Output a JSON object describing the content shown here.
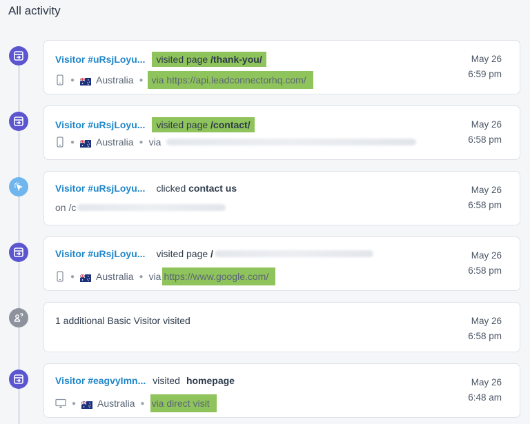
{
  "page": {
    "title": "All activity"
  },
  "colors": {
    "visit_icon": "#5b55cf",
    "click_icon": "#6fb6ef",
    "basic_icon": "#8d929c",
    "highlight": "#8fc35b",
    "link": "#1f86c9"
  },
  "activities": [
    {
      "type": "visit",
      "icon": "enter-page-icon",
      "visitor": "Visitor #uRsjLoyu...",
      "action": "visited page",
      "target": "/thank-you/",
      "device": "phone-icon",
      "country": "Australia",
      "via": "via https://api.leadconnectorhq.com/",
      "date": "May 26",
      "time": "6:59 pm"
    },
    {
      "type": "visit",
      "icon": "enter-page-icon",
      "visitor": "Visitor #uRsjLoyu...",
      "action": "visited page",
      "target": "/contact/",
      "device": "phone-icon",
      "country": "Australia",
      "via": "via",
      "date": "May 26",
      "time": "6:58 pm"
    },
    {
      "type": "click",
      "icon": "click-cursor-icon",
      "visitor": "Visitor #uRsjLoyu...",
      "action": "clicked",
      "target": "contact us",
      "on": "on /c",
      "date": "May 26",
      "time": "6:58 pm"
    },
    {
      "type": "visit",
      "icon": "enter-page-icon",
      "visitor": "Visitor #uRsjLoyu...",
      "action": "visited page",
      "target": "/",
      "device": "phone-icon",
      "country": "Australia",
      "via_prefix": "via",
      "via": "https://www.google.com/",
      "date": "May 26",
      "time": "6:58 pm"
    },
    {
      "type": "basic",
      "icon": "anonymous-visitor-icon",
      "text": "1 additional Basic Visitor visited",
      "date": "May 26",
      "time": "6:58 pm"
    },
    {
      "type": "visit",
      "icon": "enter-page-icon",
      "visitor": "Visitor #eagvyImn...",
      "action": "visited",
      "target": "homepage",
      "device": "desktop-icon",
      "country": "Australia",
      "via": "via direct visit",
      "date": "May 26",
      "time": "6:48 am"
    }
  ]
}
